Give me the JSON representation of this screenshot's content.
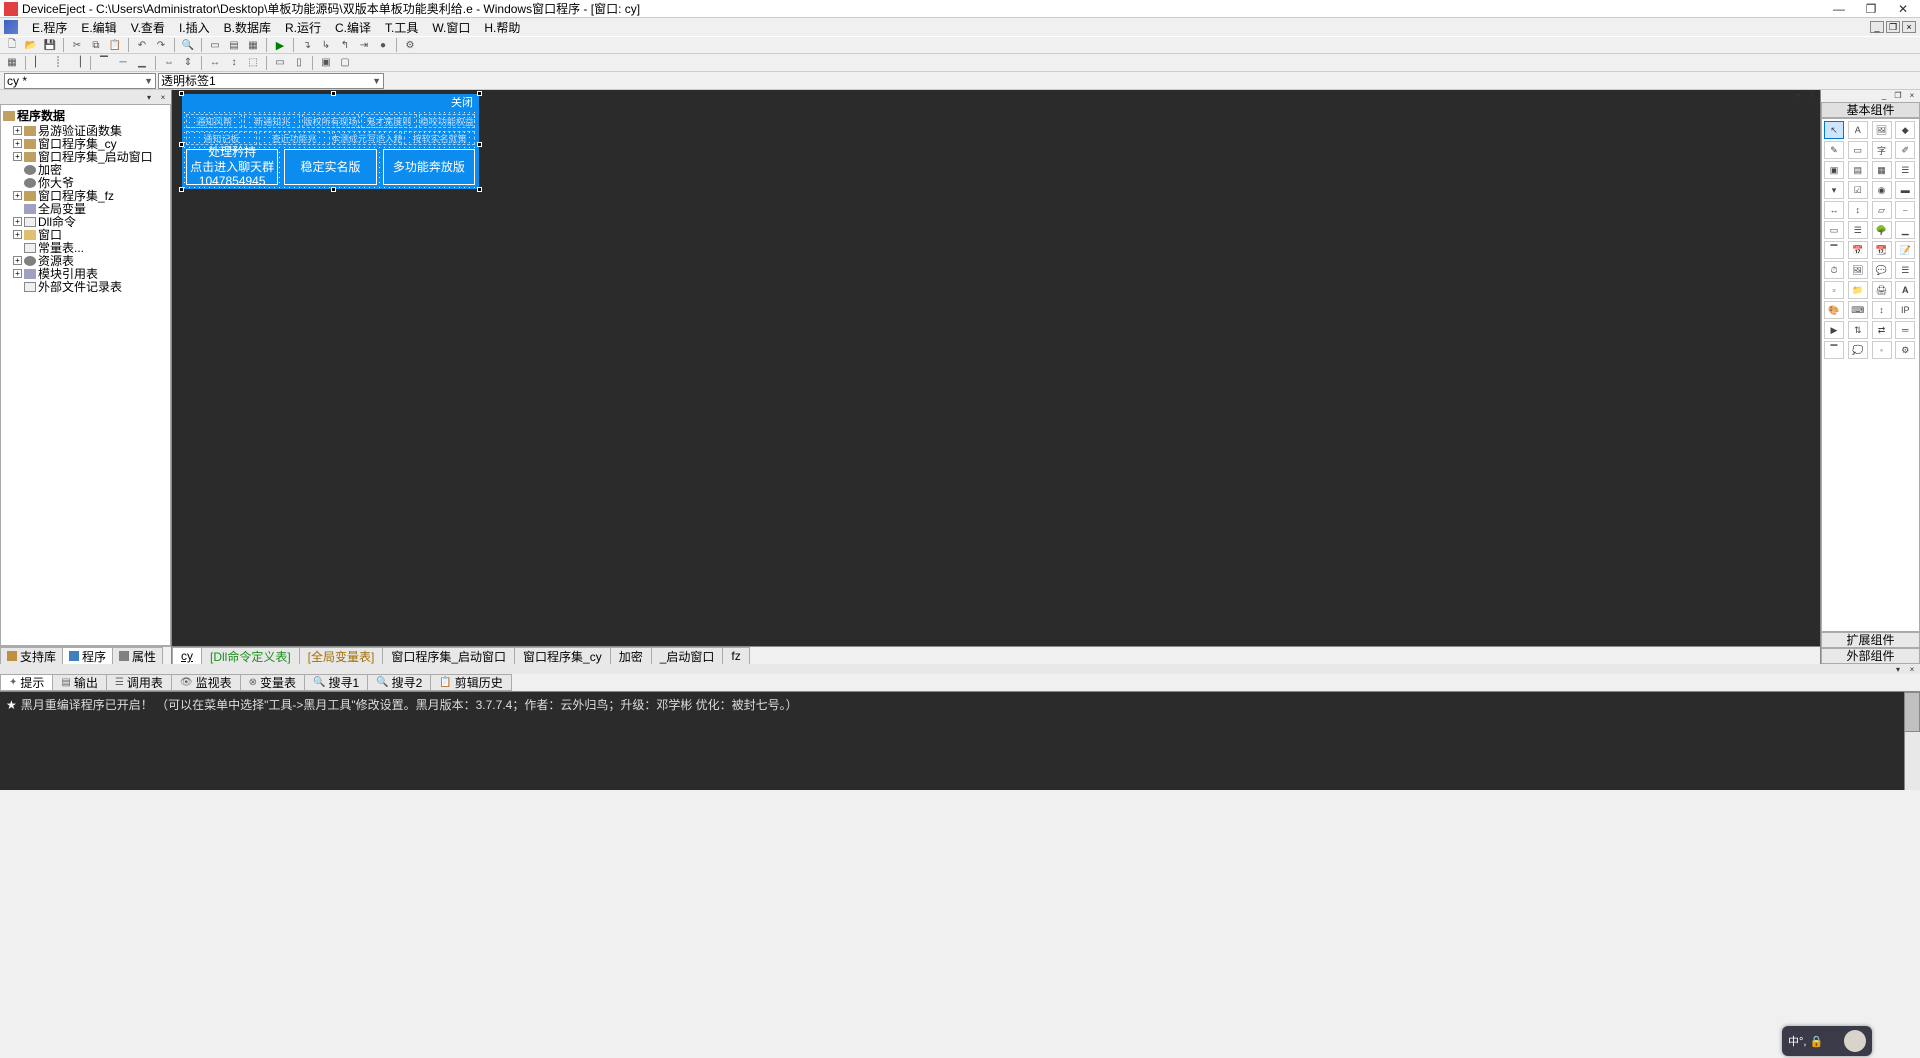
{
  "window": {
    "title": "DeviceEject - C:\\Users\\Administrator\\Desktop\\单板功能源码\\双版本单板功能奥利给.e - Windows窗口程序 - [窗口: cy]"
  },
  "menus": {
    "program": "E.程序",
    "edit": "E.编辑",
    "view": "V.查看",
    "insert": "I.插入",
    "database": "B.数据库",
    "run": "R.运行",
    "compile": "C.编译",
    "tools": "T.工具",
    "window": "W.窗口",
    "help": "H.帮助"
  },
  "combos": {
    "c1": "cy *",
    "c2": "透明标签1"
  },
  "tree": {
    "root": "程序数据",
    "items": [
      "易游验证函数集",
      "窗口程序集_cy",
      "窗口程序集_启动窗口",
      "加密",
      "你大爷",
      "窗口程序集_fz",
      "全局变量",
      "Dll命令",
      "窗口",
      "常量表...",
      "资源表",
      "模块引用表",
      "外部文件记录表"
    ]
  },
  "left_tabs": {
    "support": "支持库",
    "program": "程序",
    "property": "属性"
  },
  "form": {
    "close": "关闭",
    "row1": [
      "通知风帮",
      "新通知兆",
      "版权所有现场",
      "鬼才宽度则",
      "稳咬功能权益"
    ],
    "row2": [
      "通知记板",
      "查近功能兆",
      "成本测成元写适入精例",
      "按软实名就策"
    ],
    "btn1a": "处理矜持",
    "btn1b": "点击进入聊天群",
    "btn1c": "1047854945",
    "btn2": "稳定实名版",
    "btn3": "多功能奔放版"
  },
  "editor_tabs": [
    {
      "label": "cy",
      "active": true,
      "cls": ""
    },
    {
      "label": "[Dll命令定义表]",
      "cls": "green"
    },
    {
      "label": "[全局变量表]",
      "cls": "gold"
    },
    {
      "label": "窗口程序集_启动窗口",
      "cls": ""
    },
    {
      "label": "窗口程序集_cy",
      "cls": ""
    },
    {
      "label": "加密",
      "cls": ""
    },
    {
      "label": "_启动窗口",
      "cls": ""
    },
    {
      "label": "fz",
      "cls": ""
    }
  ],
  "right_panel": {
    "title": "基本组件",
    "ext": "扩展组件",
    "external": "外部组件"
  },
  "bottom_tabs": {
    "tips": "提示",
    "output": "输出",
    "calltable": "调用表",
    "monitor": "监视表",
    "vartable": "变量表",
    "search1": "搜寻1",
    "search2": "搜寻2",
    "cliphistory": "剪辑历史"
  },
  "output_line": "黑月重编译程序已开启！ （可以在菜单中选择\"工具->黑月工具\"修改设置。黑月版本：3.7.7.4；作者：云外归鸟；升级：邓学彬 优化：被封七号。）",
  "ime": {
    "text": "中°, 🔒"
  }
}
